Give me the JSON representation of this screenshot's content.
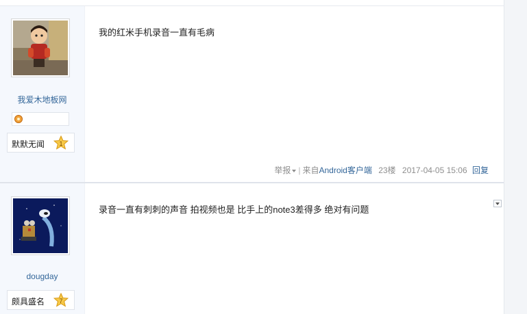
{
  "posts": [
    {
      "author": "我爱木地板网",
      "rank": "默默无闻",
      "rank_level": "1",
      "content": "我的红米手机录音一直有毛病",
      "meta": {
        "report": "举报",
        "from_prefix": "来自",
        "client": "Android客户端",
        "floor": "23楼",
        "timestamp": "2017-04-05 15:06",
        "reply": "回复"
      }
    },
    {
      "author": "dougday",
      "rank": "颇具盛名",
      "rank_level": "7",
      "content": "录音一直有刺刺的声音 拍视频也是 比手上的note3差得多 绝对有问题"
    }
  ],
  "colors": {
    "link": "#336699",
    "sidebar_bg": "#f5f8fd",
    "star": "#f7c948"
  }
}
